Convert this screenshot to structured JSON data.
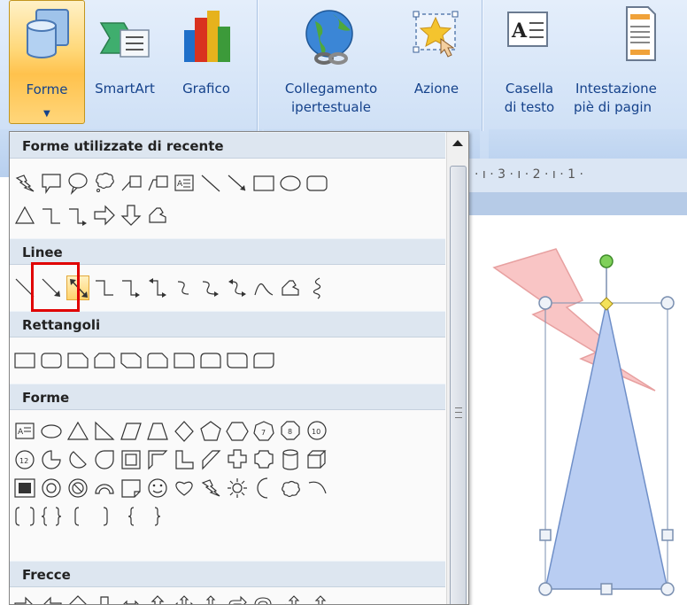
{
  "ribbon": {
    "buttons": {
      "forme": "Forme",
      "smartart": "SmartArt",
      "grafico": "Grafico",
      "collegamento_1": "Collegamento",
      "collegamento_2": "ipertestuale",
      "azione": "Azione",
      "casella_1": "Casella",
      "casella_2": "di testo",
      "intestazione_1": "Intestazione",
      "intestazione_2": "piè di pagin"
    }
  },
  "ruler": {
    "ticks": [
      "· ı · 3 · ı · 2 · ı · 1 ·"
    ]
  },
  "gallery": {
    "sections": {
      "recent": "Forme utilizzate di recente",
      "lines": "Linee",
      "rectangles": "Rettangoli",
      "shapes": "Forme",
      "arrows": "Frecce"
    }
  },
  "colors": {
    "accent_orange": "#ffd36b",
    "highlight_red": "#e00000",
    "ribbon_text": "#15428b",
    "shape_fill_blue": "#b9cdf2",
    "lightning_fill": "#f9c5c5"
  }
}
